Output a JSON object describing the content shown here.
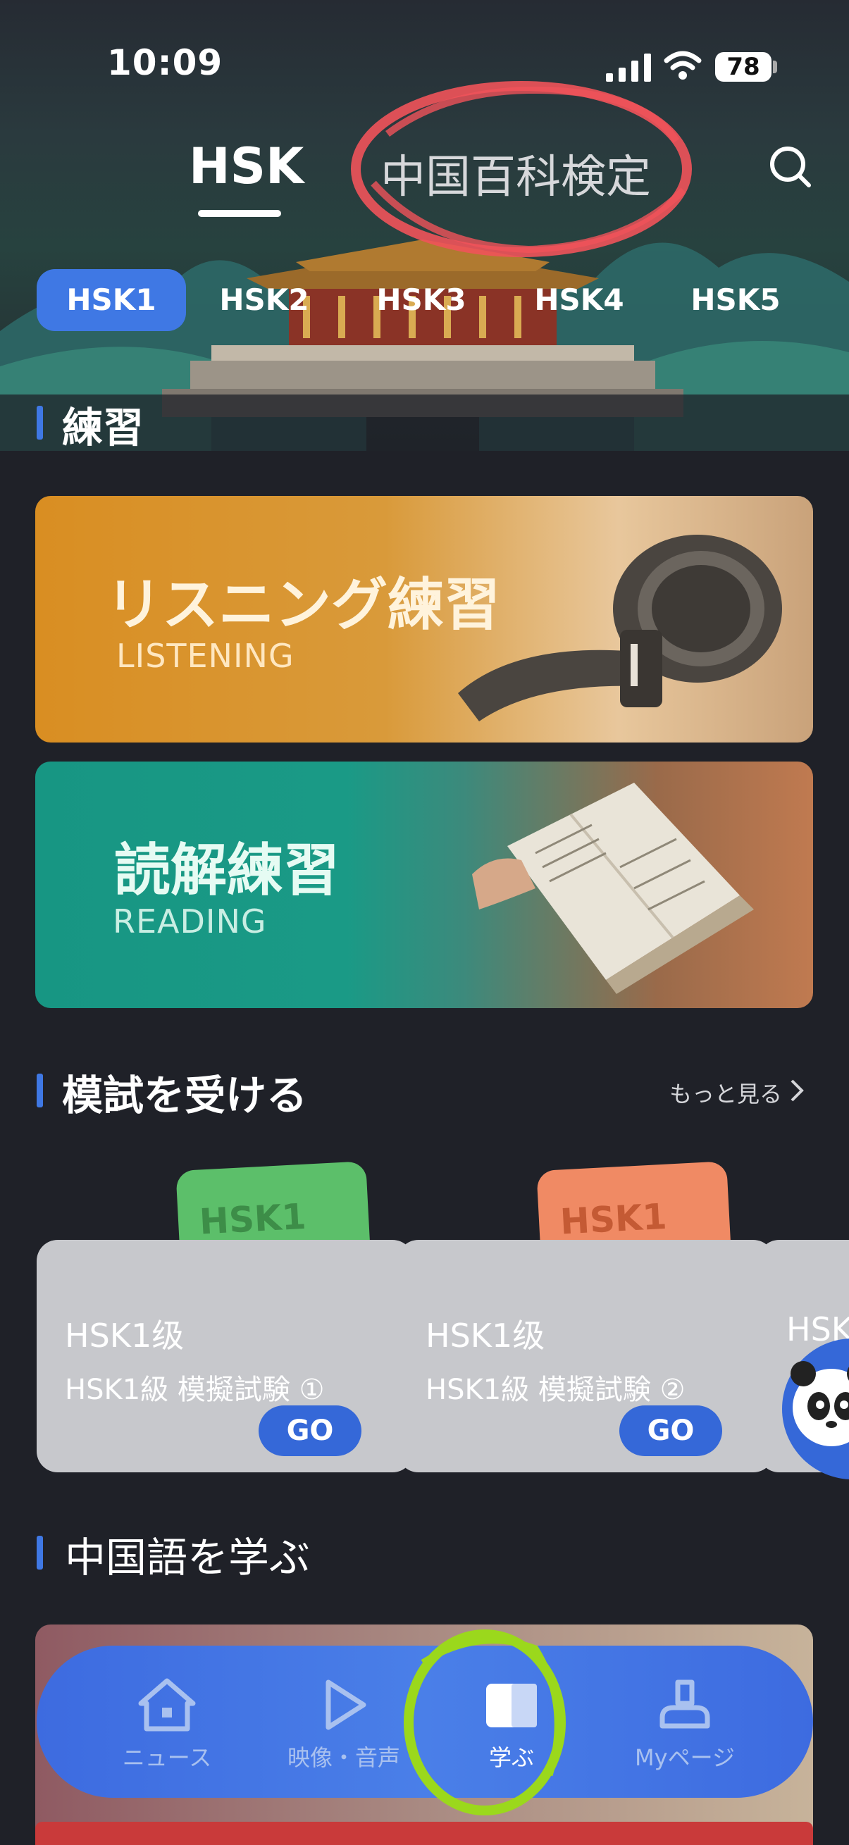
{
  "status": {
    "time": "10:09",
    "battery": "78"
  },
  "header": {
    "tab_hsk": "HSK",
    "tab_baike": "中国百科検定"
  },
  "levels": [
    "HSK1",
    "HSK2",
    "HSK3",
    "HSK4",
    "HSK5"
  ],
  "practice": {
    "title": "練習",
    "listening": {
      "title": "リスニング練習",
      "subtitle": "LISTENING"
    },
    "reading": {
      "title": "読解練習",
      "subtitle": "READING"
    }
  },
  "mock": {
    "title": "模試を受ける",
    "more": "もっと見る",
    "cards": [
      {
        "badge": "HSK1",
        "level": "HSK1级",
        "name": "HSK1級 模擬試験 ①",
        "go": "GO"
      },
      {
        "badge": "HSK1",
        "level": "HSK1级",
        "name": "HSK1級 模擬試験 ②",
        "go": "GO"
      },
      {
        "level": "HSK"
      }
    ]
  },
  "learn": {
    "title": "中国語を学ぶ"
  },
  "nav": {
    "items": [
      "ニュース",
      "映像・音声",
      "学ぶ",
      "Myページ"
    ]
  },
  "colors": {
    "accent": "#3f78e4",
    "listening": "#d98e22",
    "reading": "#1a9a86",
    "annotation_red": "#f0535a",
    "annotation_green": "#9bd81c"
  }
}
